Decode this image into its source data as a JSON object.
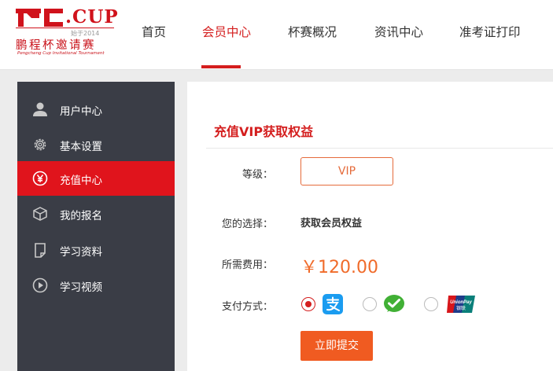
{
  "header": {
    "logo": {
      "mark": "PC",
      "cup": ".CUP",
      "year": "始于2014",
      "cn": "鹏程杯邀请赛",
      "en": "Pengcheng Cup Invitational Tournament"
    },
    "nav": [
      {
        "label": "首页"
      },
      {
        "label": "会员中心"
      },
      {
        "label": "杯赛概况"
      },
      {
        "label": "资讯中心"
      },
      {
        "label": "准考证打印"
      }
    ],
    "active_nav": "会员中心",
    "accent": "#d41e1e"
  },
  "sidebar": {
    "items": [
      {
        "label": "用户中心",
        "icon": "user-icon"
      },
      {
        "label": "基本设置",
        "icon": "gear-icon"
      },
      {
        "label": "充值中心",
        "icon": "yen-icon"
      },
      {
        "label": "我的报名",
        "icon": "box-icon"
      },
      {
        "label": "学习资料",
        "icon": "document-icon"
      },
      {
        "label": "学习视频",
        "icon": "play-icon"
      }
    ],
    "active": "充值中心",
    "bg": "#3a3d46",
    "active_bg": "#e0141c"
  },
  "content": {
    "title": "充值VIP获取权益",
    "level_label": "等级：",
    "level_value": "VIP",
    "choice_label": "您的选择：",
    "choice_value": "获取会员权益",
    "fee_label": "所需费用：",
    "fee_value": "￥120.00",
    "pay_label": "支付方式：",
    "payment_methods": [
      {
        "name": "alipay",
        "icon": "alipay-icon",
        "selected": true
      },
      {
        "name": "wechat",
        "icon": "wechat-pay-icon",
        "selected": false
      },
      {
        "name": "unionpay",
        "icon": "unionpay-icon",
        "selected": false,
        "logo_text": "UnionPay 银联"
      }
    ],
    "submit_label": "立即提交",
    "price_color": "#f06b2a",
    "button_color": "#f05b21"
  }
}
